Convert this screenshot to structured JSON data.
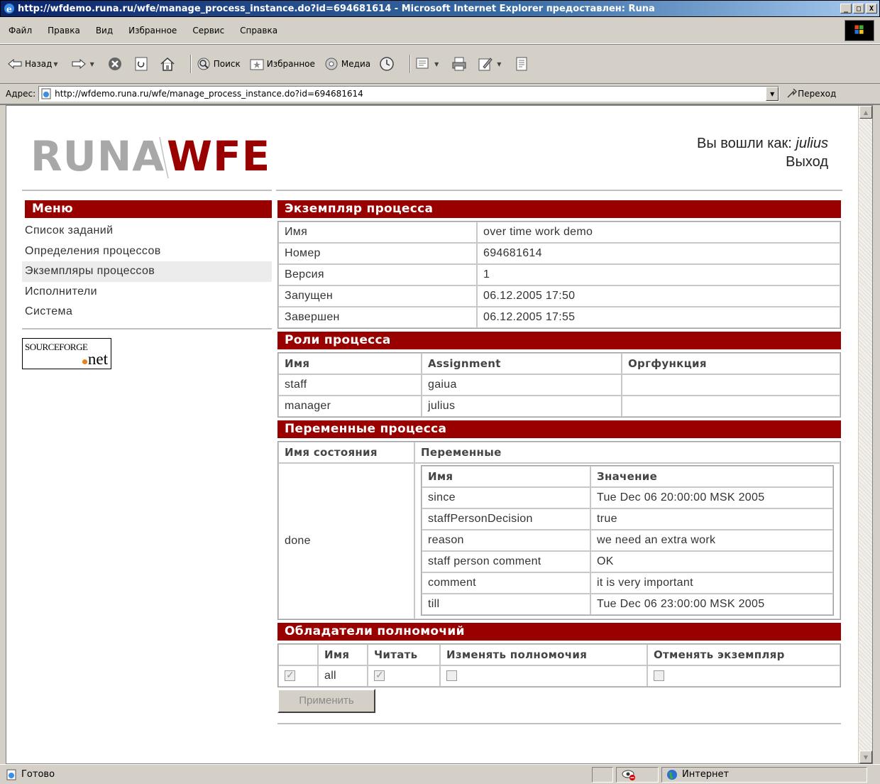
{
  "window": {
    "title": "http://wfdemo.runa.ru/wfe/manage_process_instance.do?id=694681614 - Microsoft Internet Explorer предоставлен: Runa",
    "minimize": "_",
    "maximize": "□",
    "close": "X"
  },
  "menubar": [
    "Файл",
    "Правка",
    "Вид",
    "Избранное",
    "Сервис",
    "Справка"
  ],
  "toolbar": {
    "back": "Назад",
    "search": "Поиск",
    "favorites": "Избранное",
    "media": "Медиа"
  },
  "address": {
    "label": "Адрес:",
    "url": "http://wfdemo.runa.ru/wfe/manage_process_instance.do?id=694681614",
    "go": "Переход"
  },
  "header": {
    "logo": "RUNAWFE",
    "logged_in_label": "Вы вошли как:",
    "username": "julius",
    "logout": "Выход"
  },
  "menu": {
    "title": "Меню",
    "items": [
      "Список заданий",
      "Определения процессов",
      "Экземпляры процессов",
      "Исполнители",
      "Система"
    ]
  },
  "sourceforge": {
    "line1": "SOURCEFORGE",
    "line2": "net"
  },
  "instance": {
    "title": "Экземпляр процесса",
    "rows": [
      {
        "label": "Имя",
        "value": "over time work demo"
      },
      {
        "label": "Номер",
        "value": "694681614"
      },
      {
        "label": "Версия",
        "value": "1"
      },
      {
        "label": "Запущен",
        "value": "06.12.2005 17:50"
      },
      {
        "label": "Завершен",
        "value": "06.12.2005 17:55"
      }
    ]
  },
  "roles": {
    "title": "Роли процесса",
    "headers": [
      "Имя",
      "Assignment",
      "Оргфункция"
    ],
    "rows": [
      {
        "name": "staff",
        "assignment": "gaiua",
        "orgfunction": ""
      },
      {
        "name": "manager",
        "assignment": "julius",
        "orgfunction": ""
      }
    ]
  },
  "variables": {
    "title": "Переменные процесса",
    "headers": [
      "Имя состояния",
      "Переменные"
    ],
    "state": "done",
    "inner_headers": [
      "Имя",
      "Значение"
    ],
    "rows": [
      {
        "name": "since",
        "value": "Tue Dec 06 20:00:00 MSK 2005"
      },
      {
        "name": "staffPersonDecision",
        "value": "true"
      },
      {
        "name": "reason",
        "value": "we need an extra work"
      },
      {
        "name": "staff person comment",
        "value": "OK"
      },
      {
        "name": "comment",
        "value": "it is very important"
      },
      {
        "name": "till",
        "value": "Tue Dec 06 23:00:00 MSK 2005"
      }
    ]
  },
  "permissions": {
    "title": "Обладатели полномочий",
    "headers": [
      "",
      "Имя",
      "Читать",
      "Изменять полномочия",
      "Отменять экземпляр"
    ],
    "rows": [
      {
        "selected": true,
        "name": "all",
        "read": true,
        "change": false,
        "cancel": false
      }
    ],
    "apply": "Применить"
  },
  "status": {
    "text": "Готово",
    "zone": "Интернет"
  }
}
